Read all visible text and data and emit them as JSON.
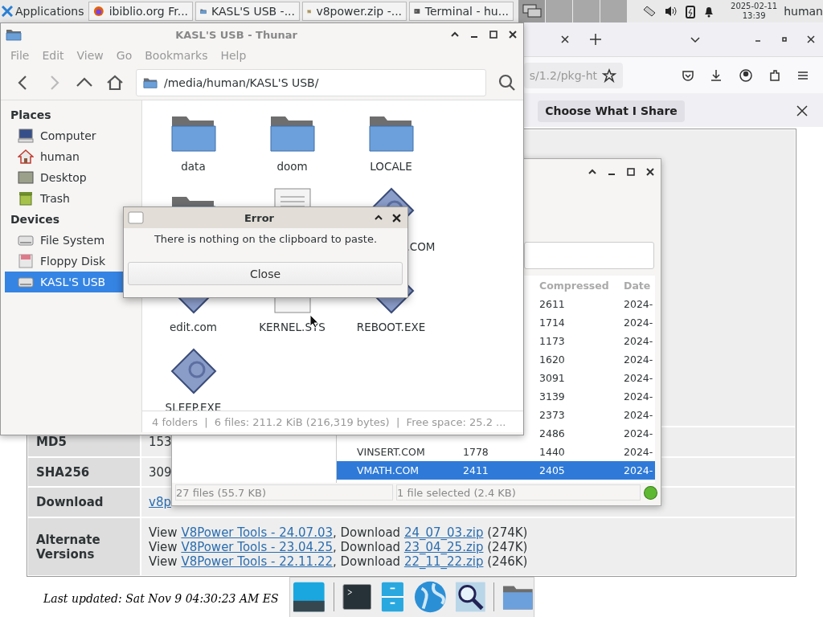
{
  "top_panel": {
    "applications_label": "Applications",
    "tasks": [
      {
        "label": "ibiblio.org Fr...",
        "kind": "browser"
      },
      {
        "label": "KASL'S USB -...",
        "kind": "folder"
      },
      {
        "label": "v8power.zip -...",
        "kind": "archive"
      },
      {
        "label": "Terminal - hu...",
        "kind": "terminal"
      }
    ],
    "clock_date": "2025-02-11",
    "clock_time": "13:39",
    "user": "human"
  },
  "browser": {
    "url_fragment": "s/1.2/pkg-ht",
    "notification_button": "Choose What I Share",
    "rows": [
      {
        "label": "MD5",
        "value": "153"
      },
      {
        "label": "SHA256",
        "value": "309"
      },
      {
        "label": "Download",
        "link": "v8p"
      }
    ],
    "alternate": {
      "label": "Alternate Versions",
      "lines": [
        {
          "view": "View",
          "title": "V8Power Tools - 24.07.03",
          "download": ", Download",
          "file": "24_07_03.zip",
          "size": "(274K)"
        },
        {
          "view": "View",
          "title": "V8Power Tools - 23.04.25",
          "download": ", Download",
          "file": "23_04_25.zip",
          "size": "(247K)"
        },
        {
          "view": "View",
          "title": "V8Power Tools - 22.11.22",
          "download": ", Download",
          "file": "22_11_22.zip",
          "size": "(246K)"
        }
      ]
    },
    "last_updated": "Last updated: Sat Nov 9 04:30:23 AM ES"
  },
  "archive": {
    "columns": [
      "Compressed",
      "Date"
    ],
    "rows": [
      {
        "compressed": "2611",
        "date": "2024-",
        "selected": false
      },
      {
        "compressed": "1714",
        "date": "2024-",
        "selected": false
      },
      {
        "compressed": "1173",
        "date": "2024-",
        "selected": false
      },
      {
        "compressed": "1620",
        "date": "2024-",
        "selected": false
      },
      {
        "compressed": "3091",
        "date": "2024-",
        "selected": false
      },
      {
        "compressed": "3139",
        "date": "2024-",
        "selected": false
      },
      {
        "compressed": "2373",
        "date": "2024-",
        "selected": false
      },
      {
        "compressed": "2486",
        "date": "2024-",
        "selected": false
      },
      {
        "name": "VINSERT.COM",
        "size": "1778",
        "compressed": "1440",
        "date": "2024-",
        "selected": false
      },
      {
        "name": "VMATH.COM",
        "size": "2411",
        "compressed": "2405",
        "date": "2024-",
        "selected": true
      }
    ],
    "status_left": "27 files  (55.7 KB)",
    "status_right": "1 file selected (2.4 KB)"
  },
  "thunar": {
    "title": "KASL'S USB - Thunar",
    "menu": [
      "File",
      "Edit",
      "View",
      "Go",
      "Bookmarks",
      "Help"
    ],
    "path": "/media/human/KASL'S USB/",
    "sidebar": [
      {
        "heading": "Places",
        "items": [
          {
            "label": "Computer",
            "kind": "computer",
            "selected": false
          },
          {
            "label": "human",
            "kind": "home",
            "selected": false
          },
          {
            "label": "Desktop",
            "kind": "desktop",
            "selected": false
          },
          {
            "label": "Trash",
            "kind": "trash",
            "selected": false
          }
        ]
      },
      {
        "heading": "Devices",
        "items": [
          {
            "label": "File System",
            "kind": "drive",
            "selected": false
          },
          {
            "label": "Floppy Disk",
            "kind": "floppy",
            "selected": false
          },
          {
            "label": "KASL'S USB",
            "kind": "drive",
            "selected": true
          }
        ]
      }
    ],
    "files": [
      {
        "kind": "folder",
        "label": "data"
      },
      {
        "kind": "folder",
        "label": "doom"
      },
      {
        "kind": "folder",
        "label": "LOCALE"
      },
      {
        "kind": "folder"
      },
      {
        "kind": "document"
      },
      {
        "kind": "program",
        "label": ".COM"
      },
      {
        "kind": "program",
        "label": "edit.com"
      },
      {
        "kind": "document",
        "label": "KERNEL.SYS"
      },
      {
        "kind": "program",
        "label": "REBOOT.EXE"
      },
      {
        "kind": "program",
        "label": "SLEEP.EXE"
      }
    ],
    "status": "4 folders  |  6 files: 211.2 KiB (216,319 bytes)  |  Free space: 25.2 ..."
  },
  "dialog": {
    "title": "Error",
    "message": "There is nothing on the clipboard to paste.",
    "button": "Close"
  }
}
